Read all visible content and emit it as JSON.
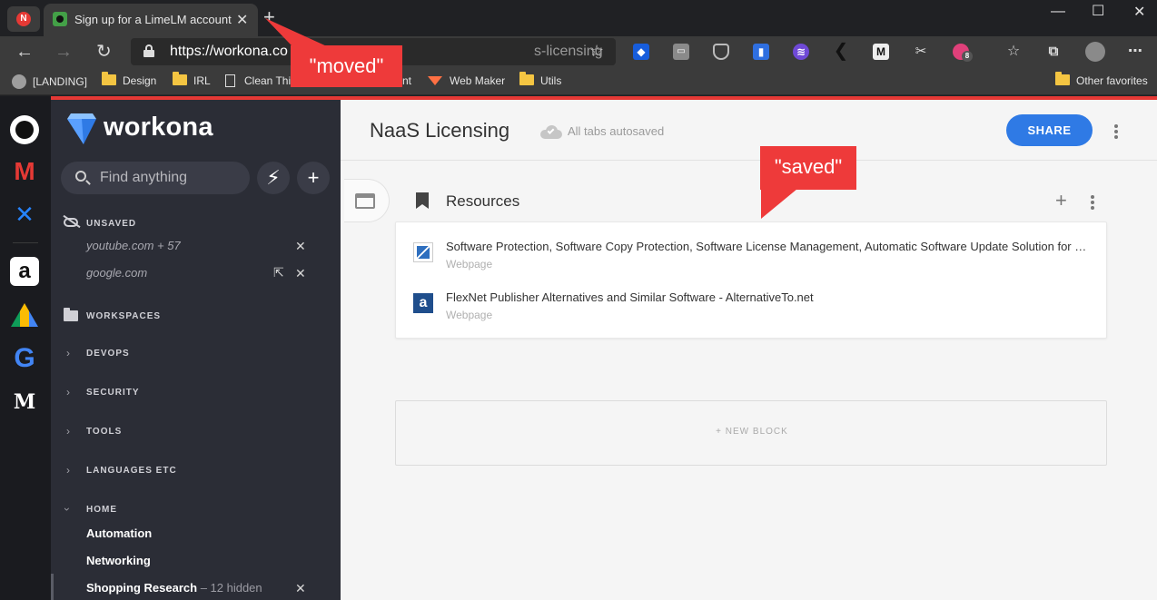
{
  "browser": {
    "pinned_tab_letter": "N",
    "active_tab_title": "Sign up for a LimeLM account",
    "url_visible": "https://workona.co",
    "url_tail": "s-licensing",
    "window_controls": {
      "minimize": "—",
      "maximize": "☐",
      "close": "✕"
    },
    "extensions": [
      {
        "name": "bitwarden-icon",
        "color": "#175ddc"
      },
      {
        "name": "briefcase-icon",
        "color": "#8a8a8a"
      },
      {
        "name": "pocket-icon",
        "color": "#555555"
      },
      {
        "name": "bookmark-ext-icon",
        "color": "#2f6fe0"
      },
      {
        "name": "tempo-icon",
        "color": "#6f49d6"
      },
      {
        "name": "chevron-left-icon",
        "color": "#111111"
      },
      {
        "name": "m-icon",
        "color": "#eeeeee",
        "text": "M"
      },
      {
        "name": "scissors-icon",
        "color": "#3b3b3b"
      },
      {
        "name": "badge-ext-icon",
        "color": "#e0407a",
        "badge": "8"
      }
    ],
    "bookmarks": [
      {
        "label": "[LANDING]",
        "icon": "orb"
      },
      {
        "label": "Design",
        "icon": "folder"
      },
      {
        "label": "IRL",
        "icon": "folder"
      },
      {
        "label": "Clean This",
        "icon": "doc"
      },
      {
        "label": "nt",
        "icon": "none"
      },
      {
        "label": "Web Maker",
        "icon": "webmaker"
      },
      {
        "label": "Utils",
        "icon": "folder"
      }
    ],
    "other_favorites": "Other favorites"
  },
  "rail": {
    "apps": [
      {
        "name": "github-icon",
        "glyph": "●",
        "bg": "#ffffff",
        "fg": "#111111"
      },
      {
        "name": "gmail-icon",
        "glyph": "M",
        "bg": "transparent",
        "fg": "#e53935"
      },
      {
        "name": "confluence-icon",
        "glyph": "✕",
        "bg": "transparent",
        "fg": "#2684ff"
      },
      {
        "name": "amazon-icon",
        "glyph": "a",
        "bg": "#ffffff",
        "fg": "#111111"
      },
      {
        "name": "drive-icon",
        "glyph": "▲",
        "bg": "transparent",
        "fg": "#fbbc04"
      },
      {
        "name": "google-icon",
        "glyph": "G",
        "bg": "transparent",
        "fg": "#4285f4"
      },
      {
        "name": "medium-icon",
        "glyph": "M",
        "bg": "#111111",
        "fg": "#ffffff"
      }
    ]
  },
  "sidebar": {
    "logo": "workona",
    "search_placeholder": "Find anything",
    "unsaved_label": "UNSAVED",
    "unsaved_items": [
      "youtube.com + 57",
      "google.com"
    ],
    "workspaces_label": "WORKSPACES",
    "groups": [
      "DEVOPS",
      "SECURITY",
      "TOOLS",
      "LANGUAGES ETC",
      "HOME"
    ],
    "home_items": [
      {
        "label": "Automation",
        "extra": ""
      },
      {
        "label": "Networking",
        "extra": ""
      },
      {
        "label": "Shopping Research",
        "extra": " – 12 hidden"
      }
    ]
  },
  "main": {
    "workspace_title": "NaaS Licensing",
    "autosave_text": "All tabs autosaved",
    "share_label": "SHARE",
    "section_title": "Resources",
    "resources": [
      {
        "title": "Software Protection, Software Copy Protection, Software License Management, Automatic Software Update Solution for Windows, Mac OS X, Linux, BSD, Solaris",
        "type": "Webpage"
      },
      {
        "title": "FlexNet Publisher Alternatives and Similar Software - AlternativeTo.net",
        "type": "Webpage"
      }
    ],
    "new_block_label": "+ NEW BLOCK"
  },
  "annotations": {
    "moved": "\"moved\"",
    "saved": "\"saved\""
  },
  "colors": {
    "accent": "#2f7ae5",
    "callout": "#ee3a3a",
    "sidebar": "#2b2d36",
    "workona_red": "#e53935"
  }
}
